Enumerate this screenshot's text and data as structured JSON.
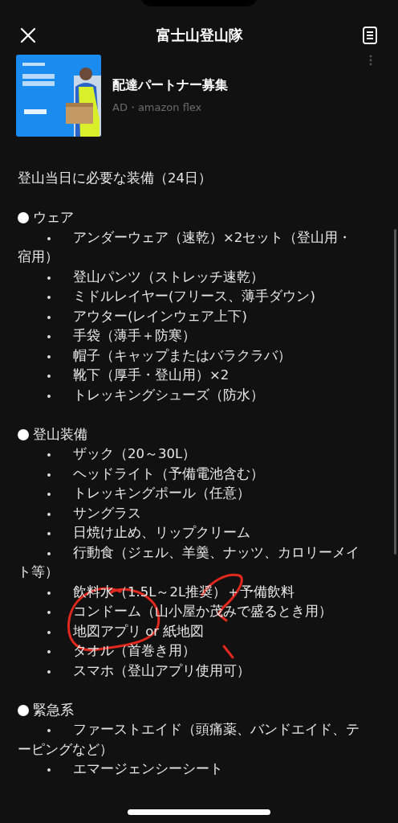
{
  "header": {
    "title": "富士山登山隊"
  },
  "ad": {
    "title": "配達パートナー募集",
    "source": "AD・amazon flex"
  },
  "note": {
    "heading": "登山当日に必要な装備（24日）",
    "sections": [
      {
        "title": "ウェア",
        "items": [
          "アンダーウェア（速乾）×2セット（登山用・宿用）",
          "登山パンツ（ストレッチ速乾）",
          "ミドルレイヤー(フリース、薄手ダウン)",
          "アウター(レインウェア上下)",
          "手袋（薄手＋防寒）",
          "帽子（キャップまたはバラクラバ）",
          "靴下（厚手・登山用）×2",
          "トレッキングシューズ（防水）"
        ]
      },
      {
        "title": "登山装備",
        "items": [
          "ザック（20～30L）",
          "ヘッドライト（予備電池含む）",
          "トレッキングポール（任意）",
          "サングラス",
          "日焼け止め、リップクリーム",
          "行動食（ジェル、羊羹、ナッツ、カロリーメイト等）",
          "飲料水（1.5L～2L推奨）＋予備飲料",
          "コンドーム（山小屋か茂みで盛るとき用）",
          "地図アプリ or 紙地図",
          "タオル（首巻き用）",
          "スマホ（登山アプリ使用可）"
        ]
      },
      {
        "title": "緊急系",
        "items": [
          "ファーストエイド（頭痛薬、バンドエイド、テーピングなど）",
          "エマージェンシーシート"
        ]
      }
    ]
  }
}
